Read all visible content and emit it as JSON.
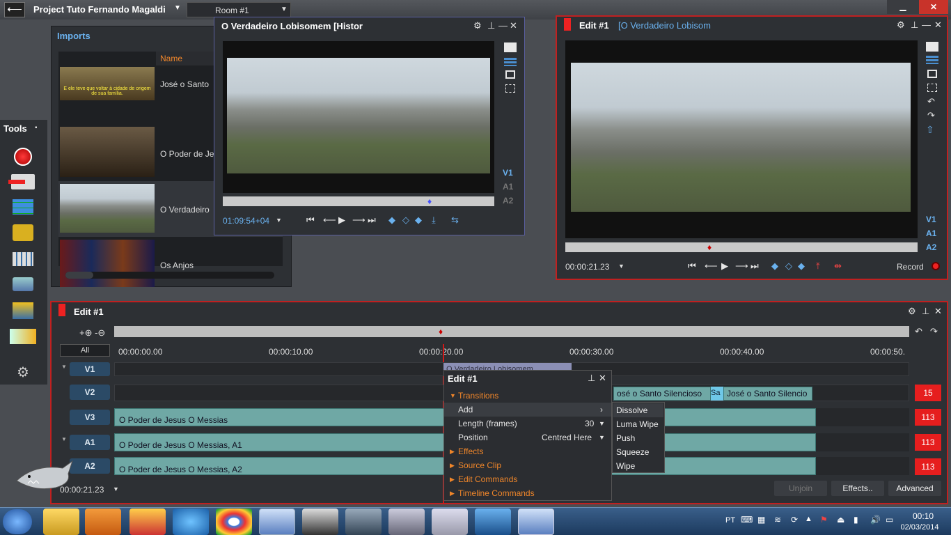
{
  "topbar": {
    "project": "Project Tuto Fernando Magaldi",
    "room": "Room #1"
  },
  "imports": {
    "title": "Imports",
    "column_name": "Name",
    "items": [
      {
        "name": "José o Santo",
        "caption": "E ele teve que voltar à cidade de origem de sua família."
      },
      {
        "name": "O Poder de Je"
      },
      {
        "name": "O Verdadeiro"
      },
      {
        "name": "Os Anjos"
      }
    ]
  },
  "tools": {
    "title": "Tools"
  },
  "source": {
    "title": "O Verdadeiro Lobisomem [Histor",
    "timecode": "01:09:54+04",
    "tracks": [
      "V1",
      "A1",
      "A2"
    ]
  },
  "record": {
    "title": "Edit #1",
    "subtitle": "[O Verdadeiro Lobisom",
    "timecode": "00:00:21.23",
    "label": "Record",
    "tracks": [
      "V1",
      "A1",
      "A2"
    ]
  },
  "timeline": {
    "title": "Edit #1",
    "zoom": "+⊕ -⊖",
    "all_label": "All",
    "ticks": [
      "00:00:00.00",
      "00:00:10.00",
      "00:00:20.00",
      "00:00:30.00",
      "00:00:40.00",
      "00:00:50."
    ],
    "tracks": [
      {
        "name": "V1",
        "badge": ""
      },
      {
        "name": "V2",
        "badge": "15",
        "clips": [
          "osé o Santo Silencioso",
          "Sa",
          "José o Santo Silencio"
        ]
      },
      {
        "name": "V3",
        "badge": "113",
        "clips": [
          "O Poder de Jesus   O Messias"
        ]
      },
      {
        "name": "A1",
        "badge": "113",
        "clips": [
          "O Poder de Jesus   O Messias, A1"
        ]
      },
      {
        "name": "A2",
        "badge": "113",
        "clips": [
          "O Poder de Jesus   O Messias, A2"
        ]
      }
    ],
    "v1_clip": "O Verdadeiro Lobisomem",
    "timecode": "00:00:21.23",
    "btn_unjoin": "Unjoin",
    "btn_effects": "Effects..",
    "btn_advanced": "Advanced"
  },
  "popup": {
    "title": "Edit #1",
    "transitions": "Transitions",
    "add": "Add",
    "length": "Length (frames)",
    "length_val": "30",
    "position": "Position",
    "position_val": "Centred Here",
    "effects": "Effects",
    "source_clip": "Source Clip",
    "edit_commands": "Edit Commands",
    "timeline_commands": "Timeline Commands",
    "submenu": [
      "Dissolve",
      "Luma Wipe",
      "Push",
      "Squeeze",
      "Wipe"
    ]
  },
  "taskbar": {
    "lang": "PT",
    "time": "00:10",
    "date": "02/03/2014"
  },
  "colors": {
    "accent": "#f0862a",
    "record": "#e61e1e",
    "blue": "#4a8fd0"
  }
}
